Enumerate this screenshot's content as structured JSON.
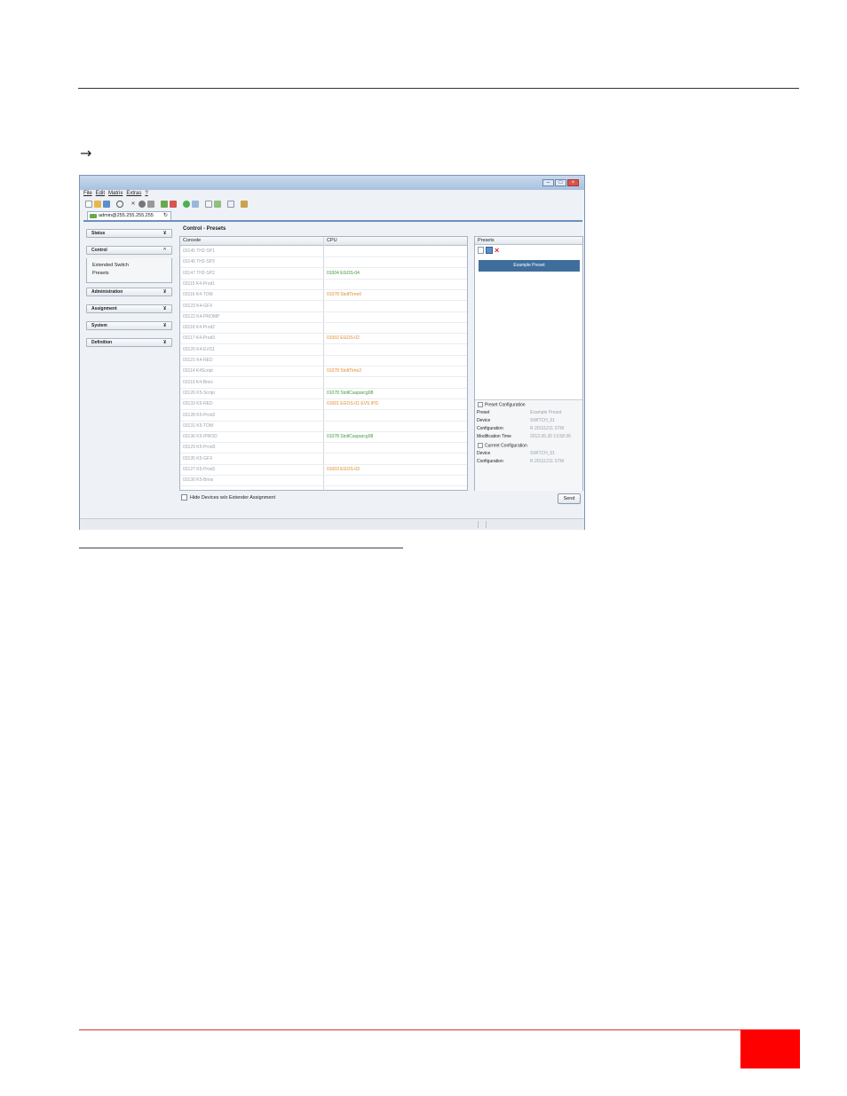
{
  "page": {
    "arrow": "→"
  },
  "window": {
    "controls": {
      "min": "–",
      "max": "□",
      "close": "×"
    },
    "menu": [
      "File",
      "Edit",
      "Matrix",
      "Extras",
      "?"
    ],
    "tab_label": "admin@255.255.255.255",
    "tab_refresh": "↻",
    "sidebar": {
      "sections": [
        {
          "label": "Status",
          "chevron": "¥"
        },
        {
          "label": "Control",
          "chevron": "^"
        },
        {
          "label": "Administration",
          "chevron": "¥"
        },
        {
          "label": "Assignment",
          "chevron": "¥"
        },
        {
          "label": "System",
          "chevron": "¥"
        },
        {
          "label": "Definition",
          "chevron": "¥"
        }
      ],
      "control_links": [
        "Extended Switch",
        "Presets"
      ]
    },
    "main_title": "Control - Presets",
    "columns": {
      "console": "Console",
      "cpu": "CPU"
    },
    "rows": [
      {
        "console": "03145  TH2-SP1",
        "cpu": "",
        "cpu_color": ""
      },
      {
        "console": "03146  TH2-SP3",
        "cpu": "",
        "cpu_color": ""
      },
      {
        "console": "03147  TH2-SP2",
        "cpu": "01004  EGOS-04",
        "cpu_color": "#3a9a3a"
      },
      {
        "console": "03115  K4-Prod1",
        "cpu": "",
        "cpu_color": ""
      },
      {
        "console": "03116  K4-TOM",
        "cpu": "01078  StoltTime0",
        "cpu_color": "#e08a2e"
      },
      {
        "console": "03123  K4-GFX",
        "cpu": "",
        "cpu_color": ""
      },
      {
        "console": "03122  K4-PROMP",
        "cpu": "",
        "cpu_color": ""
      },
      {
        "console": "03118  K4-Prod2",
        "cpu": "",
        "cpu_color": ""
      },
      {
        "console": "03117  K4-Prod3",
        "cpu": "01002  EGOS-02",
        "cpu_color": "#e08a2e"
      },
      {
        "console": "03120  K4-EVS1",
        "cpu": "",
        "cpu_color": ""
      },
      {
        "console": "03121  K4-RED",
        "cpu": "",
        "cpu_color": ""
      },
      {
        "console": "03114  K4Script",
        "cpu": "01078  StoltTime2",
        "cpu_color": "#e08a2e"
      },
      {
        "console": "03119  K4-Bmix",
        "cpu": "",
        "cpu_color": ""
      },
      {
        "console": "03126  K5-Script",
        "cpu": "01078  StoltCasparcg08",
        "cpu_color": "#3a9a3a"
      },
      {
        "console": "03133  K5-RED",
        "cpu": "01001  EGOS-01 EVS IPD",
        "cpu_color": "#e08a2e"
      },
      {
        "console": "03128  K5-Prod2",
        "cpu": "",
        "cpu_color": ""
      },
      {
        "console": "03131  K5-TOM",
        "cpu": "",
        "cpu_color": ""
      },
      {
        "console": "03136  K5-IPROD",
        "cpu": "01078  StoltCasparcg08",
        "cpu_color": "#3a9a3a"
      },
      {
        "console": "03129  K5-Prod3",
        "cpu": "",
        "cpu_color": ""
      },
      {
        "console": "03135  K5-GFX",
        "cpu": "",
        "cpu_color": ""
      },
      {
        "console": "03127  K5-Prod1",
        "cpu": "01003  EGOS-03",
        "cpu_color": "#e08a2e"
      },
      {
        "console": "03130  K5-Bmix",
        "cpu": "",
        "cpu_color": ""
      }
    ],
    "presets": {
      "header": "Presets",
      "item": "Example Preset",
      "preset_config_title": "Preset Configuration",
      "preset_config": [
        {
          "key": "Preset",
          "value": "Example Preset"
        },
        {
          "key": "Device",
          "value": "SWITCH_01"
        },
        {
          "key": "Configuration",
          "value": "R 20111211 STM"
        },
        {
          "key": "Modification Time",
          "value": "2012.05.30 13:58:36"
        }
      ],
      "current_config_title": "Current Configuration",
      "current_config": [
        {
          "key": "Device",
          "value": "SWITCH_01"
        },
        {
          "key": "Configuration",
          "value": "R 20111211 STM"
        }
      ]
    },
    "hide_label": "Hide Devices w/o Extender Assignment",
    "send_label": "Send"
  }
}
